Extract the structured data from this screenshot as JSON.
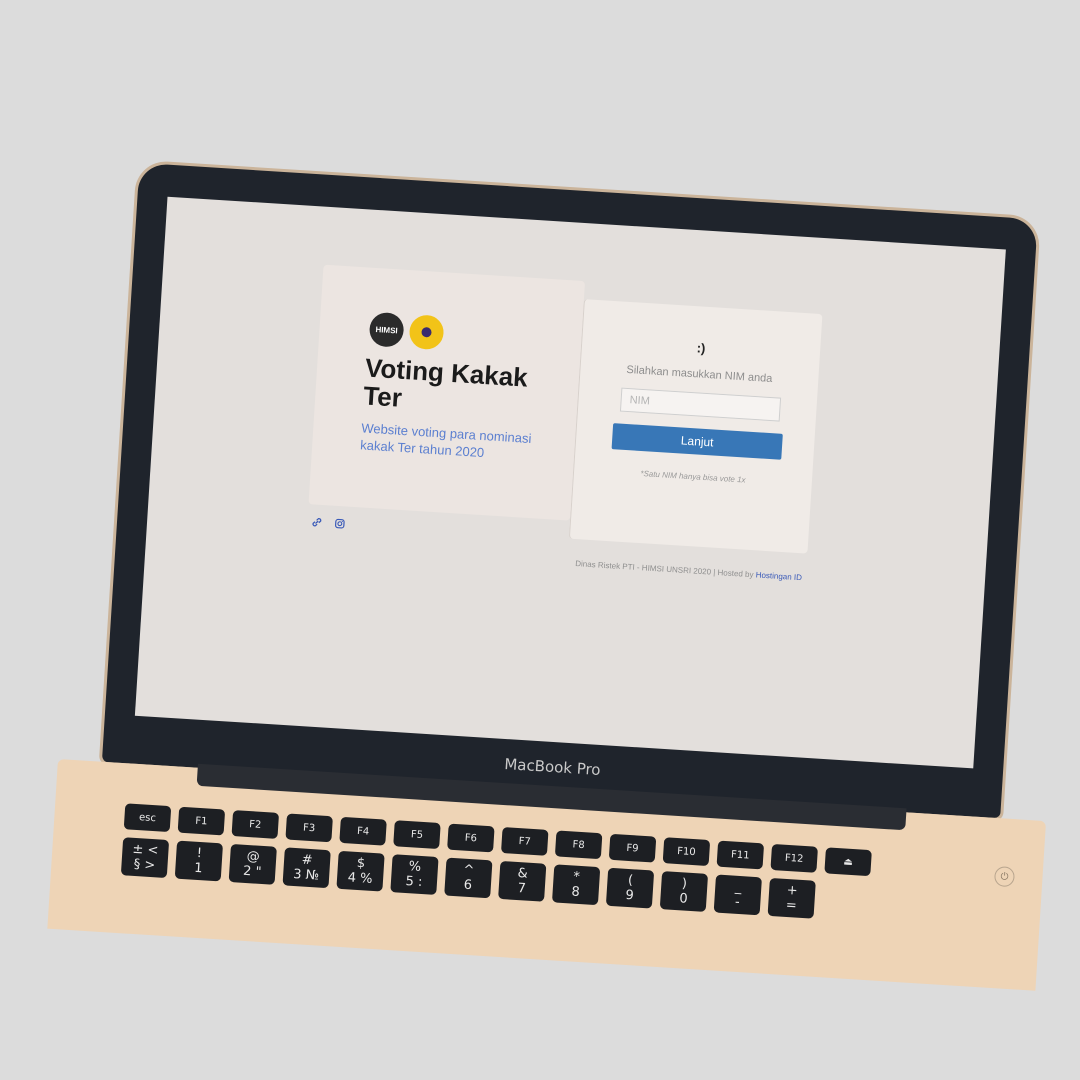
{
  "device": {
    "brand_label": "MacBook Pro"
  },
  "voting_page": {
    "title": "Voting Kakak Ter",
    "subtitle": "Website voting para nominasi kakak Ter tahun 2020",
    "logos": {
      "himsi": "HIMSI"
    },
    "login": {
      "emoticon": ":)",
      "prompt": "Silahkan masukkan NIM anda",
      "nim_placeholder": "NIM",
      "nim_value": "",
      "submit_label": "Lanjut",
      "note": "*Satu NIM hanya bisa vote 1x"
    },
    "social": {
      "link_icon": "link-icon",
      "instagram_icon": "instagram-icon"
    },
    "footer": {
      "text": "Dinas Ristek PTI - HIMSI UNSRI 2020 | Hosted by",
      "host_link": "Hostingan ID"
    },
    "colors": {
      "accent": "#3877b7",
      "subtitle": "#5b7fd0"
    }
  },
  "keyboard": {
    "row1": [
      "esc",
      "F1",
      "F2",
      "F3",
      "F4",
      "F5",
      "F6",
      "F7",
      "F8",
      "F9",
      "F10",
      "F11",
      "F12",
      "⏏"
    ],
    "row2": [
      "± <\n§ >",
      "!\n1",
      "@\n2 \"",
      "#\n3 №",
      "$\n4 %",
      "%\n5 :",
      "^\n6",
      "&\n7",
      "*\n8",
      "(\n9",
      ")\n0",
      "_\n-",
      "+\n="
    ]
  }
}
